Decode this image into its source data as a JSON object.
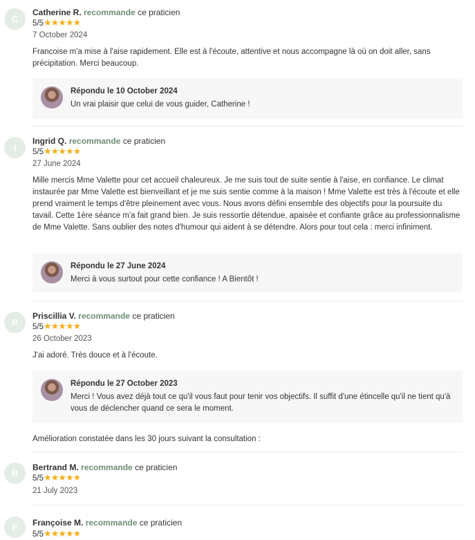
{
  "recommend_word": "recommande",
  "practitioner_suffix": "ce praticien",
  "stars": "★★★★★",
  "reviews": [
    {
      "initial": "C",
      "name": "Catherine R.",
      "score": "5/5",
      "date": "7 October 2024",
      "text": "Francoise m'a mise à l'aise rapidement. Elle est à l'écoute, attentive et nous accompagne là où on doit aller, sans précipitation. Merci beaucoup.",
      "reply_title": "Répondu le 10 October 2024",
      "reply_text": "Un vrai plaisir que celui de vous guider, Catherine !"
    },
    {
      "initial": "I",
      "name": "Ingrid Q.",
      "score": "5/5",
      "date": "27 June 2024",
      "text": "Mille mercis Mme Valette pour cet accueil chaleureux. Je me suis tout de suite sentie à l'aise, en confiance. Le climat instaurée par Mme Valette est bienveillant et je me suis sentie comme à la maison ! Mme Valette est très à l'écoute et elle prend vraiment le temps d'être pleinement avec vous. Nous avons défini ensemble des objectifs pour la poursuite du tavail. Cette 1ère séance m'a fait grand bien. Je suis ressortie détendue, apaisée et confiante grâce au professionnalisme de Mme Valette. Sans oublier des notes d'humour qui aident à se détendre. Alors pour tout cela : merci infiniment.",
      "reply_title": "Répondu le 27 June 2024",
      "reply_text": "Merci à vous surtout pour cette confiance ! A Bientôt !"
    },
    {
      "initial": "P",
      "name": "Priscillia V.",
      "score": "5/5",
      "date": "26 October 2023",
      "text": "J'ai adoré. Très douce et à l'écoute.",
      "reply_title": "Répondu le 27 October 2023",
      "reply_text": "Merci ! Vous avez déjà tout ce qu'il vous faut pour tenir vos objectifs. Il suffit d'une étincelle qu'il ne tient qu'à vous de déclencher quand ce sera le moment.",
      "improvement": "Amélioration constatée dans les 30 jours suivant la consultation :"
    },
    {
      "initial": "B",
      "name": "Bertrand M.",
      "score": "5/5",
      "date": "21 July 2023"
    },
    {
      "initial": "F",
      "name": "Françoise M.",
      "score": "5/5"
    }
  ]
}
